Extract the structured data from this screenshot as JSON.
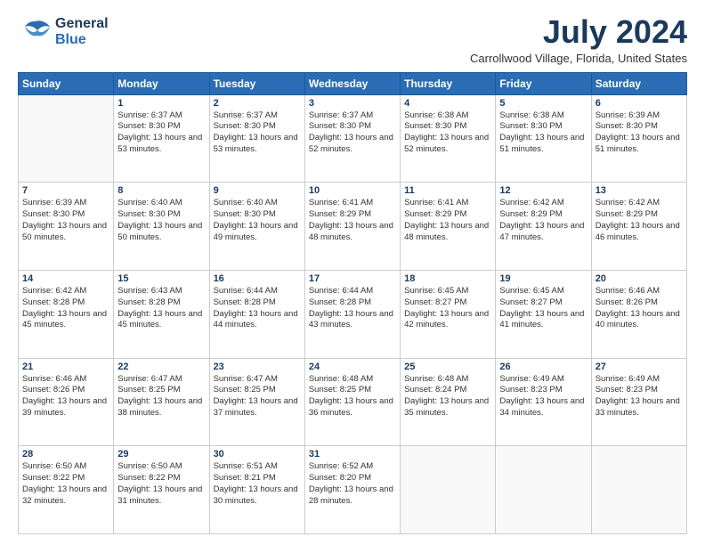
{
  "logo": {
    "general": "General",
    "blue": "Blue"
  },
  "header": {
    "month": "July 2024",
    "location": "Carrollwood Village, Florida, United States"
  },
  "weekdays": [
    "Sunday",
    "Monday",
    "Tuesday",
    "Wednesday",
    "Thursday",
    "Friday",
    "Saturday"
  ],
  "weeks": [
    [
      {
        "day": "",
        "info": ""
      },
      {
        "day": "1",
        "info": "Sunrise: 6:37 AM\nSunset: 8:30 PM\nDaylight: 13 hours\nand 53 minutes."
      },
      {
        "day": "2",
        "info": "Sunrise: 6:37 AM\nSunset: 8:30 PM\nDaylight: 13 hours\nand 53 minutes."
      },
      {
        "day": "3",
        "info": "Sunrise: 6:37 AM\nSunset: 8:30 PM\nDaylight: 13 hours\nand 52 minutes."
      },
      {
        "day": "4",
        "info": "Sunrise: 6:38 AM\nSunset: 8:30 PM\nDaylight: 13 hours\nand 52 minutes."
      },
      {
        "day": "5",
        "info": "Sunrise: 6:38 AM\nSunset: 8:30 PM\nDaylight: 13 hours\nand 51 minutes."
      },
      {
        "day": "6",
        "info": "Sunrise: 6:39 AM\nSunset: 8:30 PM\nDaylight: 13 hours\nand 51 minutes."
      }
    ],
    [
      {
        "day": "7",
        "info": "Sunrise: 6:39 AM\nSunset: 8:30 PM\nDaylight: 13 hours\nand 50 minutes."
      },
      {
        "day": "8",
        "info": "Sunrise: 6:40 AM\nSunset: 8:30 PM\nDaylight: 13 hours\nand 50 minutes."
      },
      {
        "day": "9",
        "info": "Sunrise: 6:40 AM\nSunset: 8:30 PM\nDaylight: 13 hours\nand 49 minutes."
      },
      {
        "day": "10",
        "info": "Sunrise: 6:41 AM\nSunset: 8:29 PM\nDaylight: 13 hours\nand 48 minutes."
      },
      {
        "day": "11",
        "info": "Sunrise: 6:41 AM\nSunset: 8:29 PM\nDaylight: 13 hours\nand 48 minutes."
      },
      {
        "day": "12",
        "info": "Sunrise: 6:42 AM\nSunset: 8:29 PM\nDaylight: 13 hours\nand 47 minutes."
      },
      {
        "day": "13",
        "info": "Sunrise: 6:42 AM\nSunset: 8:29 PM\nDaylight: 13 hours\nand 46 minutes."
      }
    ],
    [
      {
        "day": "14",
        "info": "Sunrise: 6:42 AM\nSunset: 8:28 PM\nDaylight: 13 hours\nand 45 minutes."
      },
      {
        "day": "15",
        "info": "Sunrise: 6:43 AM\nSunset: 8:28 PM\nDaylight: 13 hours\nand 45 minutes."
      },
      {
        "day": "16",
        "info": "Sunrise: 6:44 AM\nSunset: 8:28 PM\nDaylight: 13 hours\nand 44 minutes."
      },
      {
        "day": "17",
        "info": "Sunrise: 6:44 AM\nSunset: 8:28 PM\nDaylight: 13 hours\nand 43 minutes."
      },
      {
        "day": "18",
        "info": "Sunrise: 6:45 AM\nSunset: 8:27 PM\nDaylight: 13 hours\nand 42 minutes."
      },
      {
        "day": "19",
        "info": "Sunrise: 6:45 AM\nSunset: 8:27 PM\nDaylight: 13 hours\nand 41 minutes."
      },
      {
        "day": "20",
        "info": "Sunrise: 6:46 AM\nSunset: 8:26 PM\nDaylight: 13 hours\nand 40 minutes."
      }
    ],
    [
      {
        "day": "21",
        "info": "Sunrise: 6:46 AM\nSunset: 8:26 PM\nDaylight: 13 hours\nand 39 minutes."
      },
      {
        "day": "22",
        "info": "Sunrise: 6:47 AM\nSunset: 8:25 PM\nDaylight: 13 hours\nand 38 minutes."
      },
      {
        "day": "23",
        "info": "Sunrise: 6:47 AM\nSunset: 8:25 PM\nDaylight: 13 hours\nand 37 minutes."
      },
      {
        "day": "24",
        "info": "Sunrise: 6:48 AM\nSunset: 8:25 PM\nDaylight: 13 hours\nand 36 minutes."
      },
      {
        "day": "25",
        "info": "Sunrise: 6:48 AM\nSunset: 8:24 PM\nDaylight: 13 hours\nand 35 minutes."
      },
      {
        "day": "26",
        "info": "Sunrise: 6:49 AM\nSunset: 8:23 PM\nDaylight: 13 hours\nand 34 minutes."
      },
      {
        "day": "27",
        "info": "Sunrise: 6:49 AM\nSunset: 8:23 PM\nDaylight: 13 hours\nand 33 minutes."
      }
    ],
    [
      {
        "day": "28",
        "info": "Sunrise: 6:50 AM\nSunset: 8:22 PM\nDaylight: 13 hours\nand 32 minutes."
      },
      {
        "day": "29",
        "info": "Sunrise: 6:50 AM\nSunset: 8:22 PM\nDaylight: 13 hours\nand 31 minutes."
      },
      {
        "day": "30",
        "info": "Sunrise: 6:51 AM\nSunset: 8:21 PM\nDaylight: 13 hours\nand 30 minutes."
      },
      {
        "day": "31",
        "info": "Sunrise: 6:52 AM\nSunset: 8:20 PM\nDaylight: 13 hours\nand 28 minutes."
      },
      {
        "day": "",
        "info": ""
      },
      {
        "day": "",
        "info": ""
      },
      {
        "day": "",
        "info": ""
      }
    ]
  ]
}
